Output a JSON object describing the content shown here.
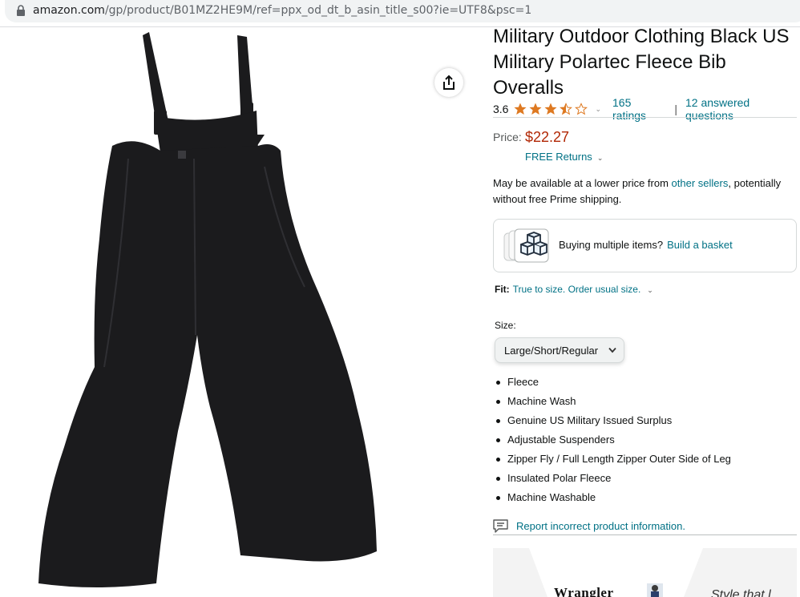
{
  "browser": {
    "url_host": "amazon.com",
    "url_path": "/gp/product/B01MZ2HE9M/ref=ppx_od_dt_b_asin_title_s00?ie=UTF8&psc=1"
  },
  "product": {
    "title": "Military Outdoor Clothing Black US Military Polartec Fleece Bib Overalls",
    "rating_value": "3.6",
    "rating_stars": 3.5,
    "ratings_count": "165 ratings",
    "separator": "|",
    "answered_questions": "12 answered questions",
    "price_label": "Price:",
    "price": "$22.27",
    "returns_label": "FREE Returns"
  },
  "availability": {
    "prefix": "May be available at a lower price from ",
    "link": "other sellers",
    "suffix": ", potentially without free Prime shipping."
  },
  "basket": {
    "text": "Buying multiple items?",
    "link": "Build a basket"
  },
  "fit": {
    "label": "Fit:",
    "value": "True to size. Order usual size."
  },
  "size": {
    "label": "Size:",
    "selected": "Large/Short/Regular"
  },
  "bullets": [
    "Fleece",
    "Machine Wash",
    "Genuine US Military Issued Surplus",
    "Adjustable Suspenders",
    "Zipper Fly / Full Length Zipper Outer Side of Leg",
    "Insulated Polar Fleece",
    "Machine Washable"
  ],
  "report": {
    "link": "Report incorrect product information."
  },
  "ad": {
    "brand": "Wrangler",
    "tagline": "Style that l"
  },
  "colors": {
    "link": "#007185",
    "price": "#b12704",
    "star": "#de7921",
    "garment": "#1b1b1d"
  },
  "icons": {
    "lock": "lock-icon",
    "share": "share-icon",
    "basket": "boxes-icon",
    "report": "feedback-icon",
    "chevron": "chevron-down-icon"
  }
}
